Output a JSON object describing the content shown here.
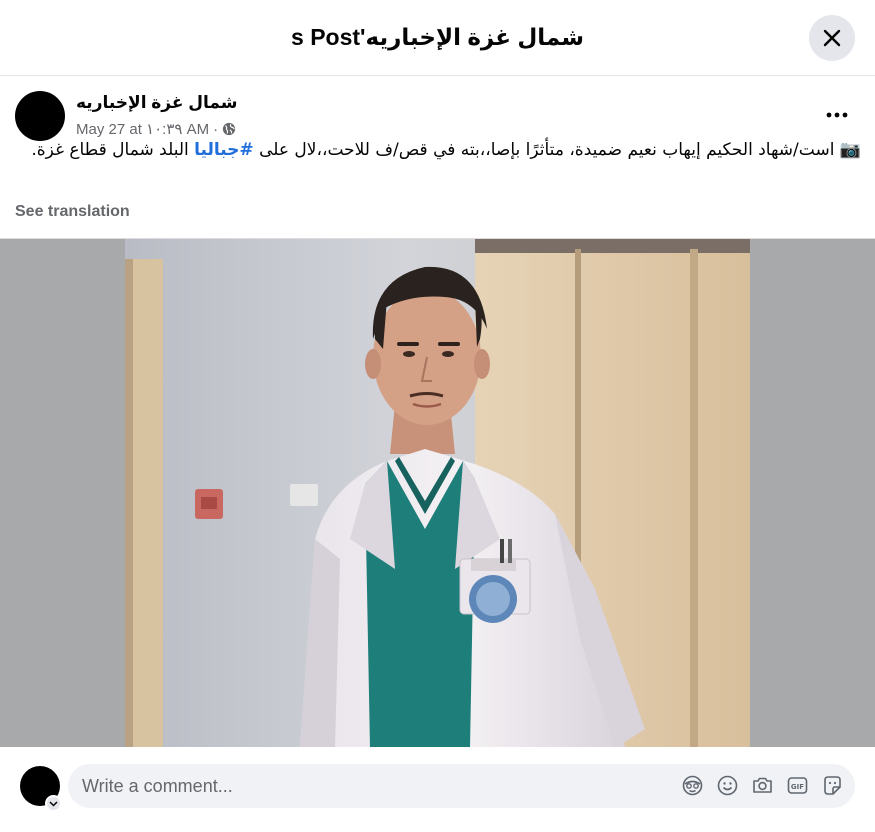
{
  "dialog": {
    "title": "شمال غزة الإخباريه's Post"
  },
  "post": {
    "author": "شمال غزة الإخباريه",
    "date": "May 27 at ١٠:٣٩ AM",
    "separator": "·",
    "text_before": "📷 است/شهاد الحكيم إيهاب نعيم ضميدة، متأثرًا بإصا،،بته في قص/ف للاحت،،لال على ",
    "hashtag": "#جباليا",
    "text_after": " البلد شمال قطاع غزة.",
    "see_translation": "See translation"
  },
  "comment": {
    "placeholder": "Write a comment..."
  },
  "icons": {
    "close": "close-icon",
    "more": "more-options-icon",
    "globe": "globe-icon",
    "avatar_sticker": "avatar-sticker-icon",
    "emoji": "emoji-icon",
    "camera": "camera-icon",
    "gif": "gif-icon",
    "sticker": "sticker-icon",
    "chevron": "chevron-down-icon"
  },
  "colors": {
    "hashtag": "#216fdb",
    "muted": "#65676b",
    "photo_backdrop": "#a8a9ab"
  }
}
